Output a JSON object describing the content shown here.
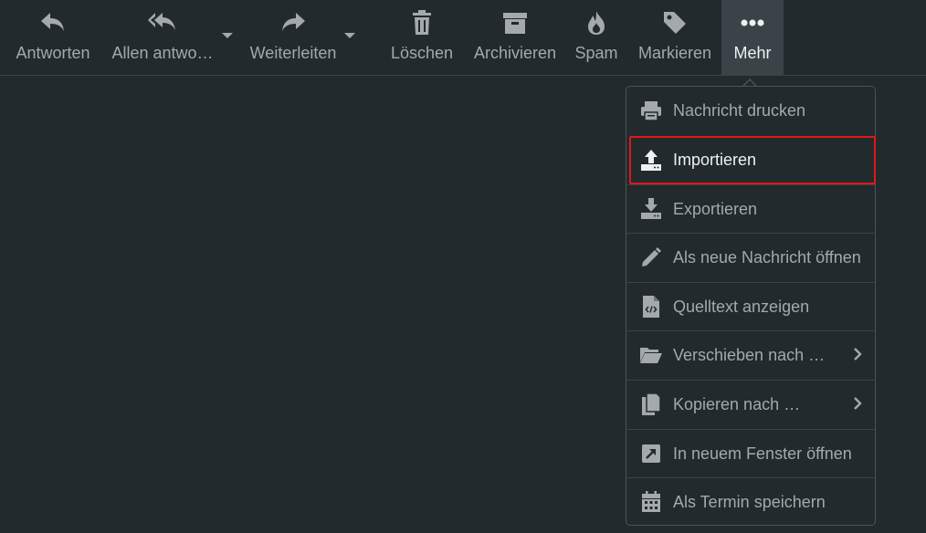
{
  "colors": {
    "background": "#222a2d",
    "icon_muted": "#a3a9ac",
    "text_active": "#eef1f2",
    "active_bg": "#3a4448",
    "highlight_border": "#e0161b"
  },
  "toolbar": {
    "reply": {
      "label": "Antworten",
      "icon": "reply-icon"
    },
    "reply_all": {
      "label": "Allen antwo…",
      "icon": "reply-all-icon"
    },
    "forward": {
      "label": "Weiterleiten",
      "icon": "forward-icon"
    },
    "delete": {
      "label": "Löschen",
      "icon": "trash-icon"
    },
    "archive": {
      "label": "Archivieren",
      "icon": "archive-box-icon"
    },
    "spam": {
      "label": "Spam",
      "icon": "fire-icon"
    },
    "mark": {
      "label": "Markieren",
      "icon": "tag-icon"
    },
    "more": {
      "label": "Mehr",
      "icon": "ellipsis-icon"
    }
  },
  "menu": {
    "items": [
      {
        "label": "Nachricht drucken",
        "icon": "printer-icon"
      },
      {
        "label": "Importieren",
        "icon": "upload-icon"
      },
      {
        "label": "Exportieren",
        "icon": "download-icon"
      },
      {
        "label": "Als neue Nachricht öffnen",
        "icon": "pencil-icon"
      },
      {
        "label": "Quelltext anzeigen",
        "icon": "code-file-icon"
      },
      {
        "label": "Verschieben nach …",
        "icon": "folder-open-icon"
      },
      {
        "label": "Kopieren nach …",
        "icon": "copy-icon"
      },
      {
        "label": "In neuem Fenster öffnen",
        "icon": "external-window-icon"
      },
      {
        "label": "Als Termin speichern",
        "icon": "calendar-icon"
      }
    ]
  }
}
